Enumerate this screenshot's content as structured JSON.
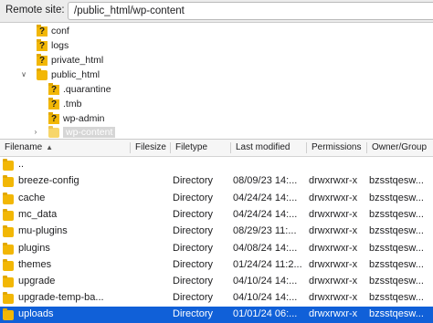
{
  "site": {
    "label": "Remote site:",
    "path": "/public_html/wp-content"
  },
  "tree": [
    {
      "label": "conf",
      "icon": "unknown-folder-icon"
    },
    {
      "label": "logs",
      "icon": "unknown-folder-icon"
    },
    {
      "label": "private_html",
      "icon": "unknown-folder-icon"
    },
    {
      "label": "public_html",
      "icon": "folder-icon",
      "expanded": true
    },
    {
      "label": ".quarantine",
      "icon": "unknown-folder-icon"
    },
    {
      "label": ".tmb",
      "icon": "unknown-folder-icon"
    },
    {
      "label": "wp-admin",
      "icon": "unknown-folder-icon"
    },
    {
      "label": "wp-content",
      "icon": "folder-icon",
      "selected": true
    }
  ],
  "columns": {
    "filename": "Filename",
    "filesize": "Filesize",
    "filetype": "Filetype",
    "modified": "Last modified",
    "permissions": "Permissions",
    "owner": "Owner/Group"
  },
  "rows": [
    {
      "name": "..",
      "type": "",
      "modified": "",
      "perms": "",
      "owner": ""
    },
    {
      "name": "breeze-config",
      "type": "Directory",
      "modified": "08/09/23 14:...",
      "perms": "drwxrwxr-x",
      "owner": "bzsstqesw..."
    },
    {
      "name": "cache",
      "type": "Directory",
      "modified": "04/24/24 14:...",
      "perms": "drwxrwxr-x",
      "owner": "bzsstqesw..."
    },
    {
      "name": "mc_data",
      "type": "Directory",
      "modified": "04/24/24 14:...",
      "perms": "drwxrwxr-x",
      "owner": "bzsstqesw..."
    },
    {
      "name": "mu-plugins",
      "type": "Directory",
      "modified": "08/29/23 11:...",
      "perms": "drwxrwxr-x",
      "owner": "bzsstqesw..."
    },
    {
      "name": "plugins",
      "type": "Directory",
      "modified": "04/08/24 14:...",
      "perms": "drwxrwxr-x",
      "owner": "bzsstqesw..."
    },
    {
      "name": "themes",
      "type": "Directory",
      "modified": "01/24/24 11:2...",
      "perms": "drwxrwxr-x",
      "owner": "bzsstqesw..."
    },
    {
      "name": "upgrade",
      "type": "Directory",
      "modified": "04/10/24 14:...",
      "perms": "drwxrwxr-x",
      "owner": "bzsstqesw..."
    },
    {
      "name": "upgrade-temp-ba...",
      "type": "Directory",
      "modified": "04/10/24 14:...",
      "perms": "drwxrwxr-x",
      "owner": "bzsstqesw..."
    },
    {
      "name": "uploads",
      "type": "Directory",
      "modified": "01/01/24 06:...",
      "perms": "drwxrwxr-x",
      "owner": "bzsstqesw...",
      "selected": true
    }
  ]
}
